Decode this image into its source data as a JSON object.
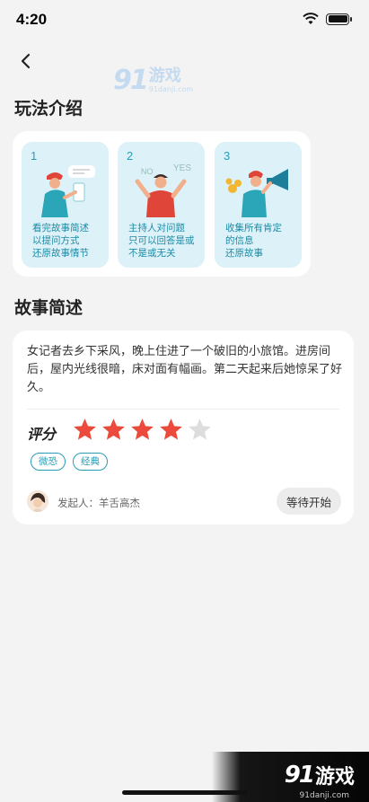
{
  "status": {
    "time": "4:20"
  },
  "watermark": {
    "logo": "91",
    "title": "游戏",
    "url": "91danji.com"
  },
  "sections": {
    "intro_title": "玩法介绍",
    "story_title": "故事简述"
  },
  "steps": [
    {
      "num": "1",
      "line1": "看完故事简述",
      "line2": "以提问方式",
      "line3": "还原故事情节"
    },
    {
      "num": "2",
      "line1": "主持人对问题",
      "line2": "只可以回答是或",
      "line3": "不是或无关",
      "no": "NO",
      "yes": "YES"
    },
    {
      "num": "3",
      "line1": "收集所有肯定",
      "line2": "的信息",
      "line3": "还原故事"
    }
  ],
  "story": {
    "text": "女记者去乡下采风，晚上住进了一个破旧的小旅馆。进房间后，屋内光线很暗，床对面有幅画。第二天起来后她惊呆了好久。",
    "rating_label": "评分",
    "rating": 4,
    "rating_max": 5,
    "tags": [
      "微恐",
      "经典"
    ],
    "initiator": "发起人：羊舌高杰",
    "start_label": "等待开始"
  },
  "colors": {
    "accent": "#2a9bb5",
    "star_on": "#ec4a3c",
    "star_off": "#dddddd",
    "step_bg": "#ddf2f8"
  }
}
